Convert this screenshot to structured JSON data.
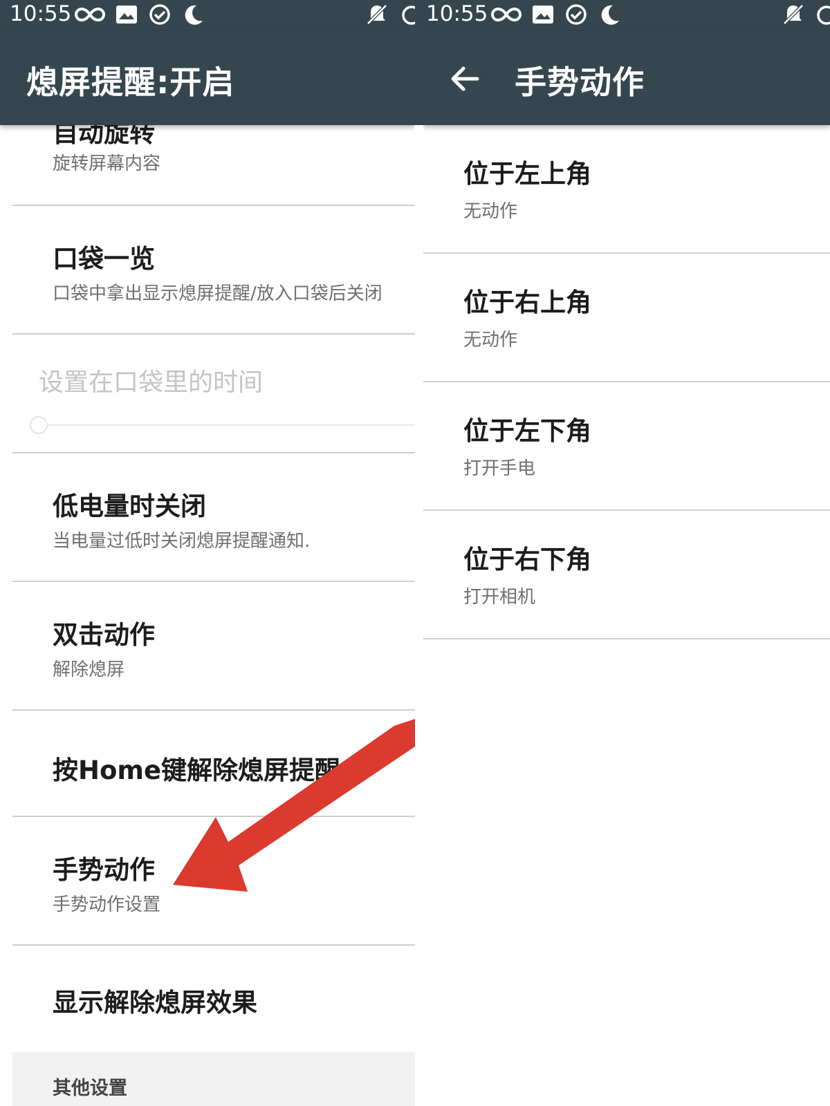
{
  "status": {
    "time": "10:55"
  },
  "left": {
    "title": "熄屏提醒:开启",
    "partial_title": "自动旋转",
    "partial_subtitle": "旋转屏幕内容",
    "items": [
      {
        "title": "口袋一览",
        "subtitle": "口袋中拿出显示熄屏提醒/放入口袋后关闭"
      },
      {
        "title": "设置在口袋里的时间"
      },
      {
        "title": "低电量时关闭",
        "subtitle": "当电量过低时关闭熄屏提醒通知."
      },
      {
        "title": "双击动作",
        "subtitle": "解除熄屏"
      },
      {
        "title": "按Home键解除熄屏提醒"
      },
      {
        "title": "手势动作",
        "subtitle": "手势动作设置"
      },
      {
        "title": "显示解除熄屏效果"
      }
    ],
    "section_header": "其他设置"
  },
  "right": {
    "title": "手势动作",
    "items": [
      {
        "title": "位于左上角",
        "subtitle": "无动作"
      },
      {
        "title": "位于右上角",
        "subtitle": "无动作"
      },
      {
        "title": "位于左下角",
        "subtitle": "打开手电"
      },
      {
        "title": "位于右下角",
        "subtitle": "打开相机"
      }
    ]
  },
  "colors": {
    "toolbar": "#36464e",
    "annotation_arrow": "#db3a2f"
  }
}
